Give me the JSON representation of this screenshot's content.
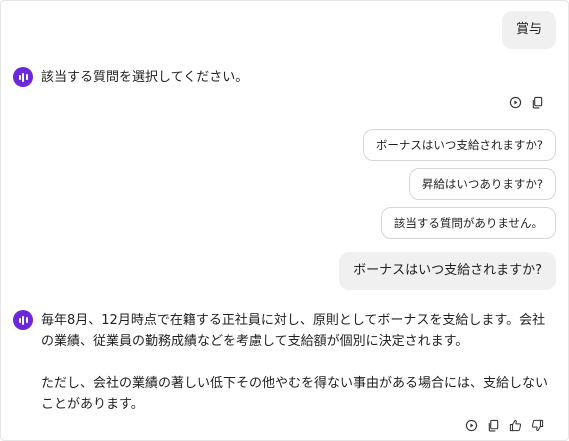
{
  "messages": {
    "user_1": "賞与",
    "bot_1": "該当する質問を選択してください。",
    "choices": [
      "ボーナスはいつ支給されますか?",
      "昇給はいつありますか?",
      "該当する質問がありません。"
    ],
    "user_2": "ボーナスはいつ支給されますか?",
    "bot_2_para1": "毎年8月、12月時点で在籍する正社員に対し、原則としてボーナスを支給します。会社の業績、従業員の勤務成績などを考慮して支給額が個別に決定されます。",
    "bot_2_para2": "ただし、会社の業績の著しい低下その他やむを得ない事由がある場合には、支給しないことがあります。"
  },
  "icons": {
    "avatar": "audio-waveform-icon",
    "play": "play-icon",
    "copy": "copy-icon",
    "thumbs_up": "thumbs-up-icon",
    "thumbs_down": "thumbs-down-icon"
  },
  "colors": {
    "avatar": "#6d28d9",
    "user_bubble": "#f0f0f0",
    "chip_border": "#d6d6d6"
  }
}
